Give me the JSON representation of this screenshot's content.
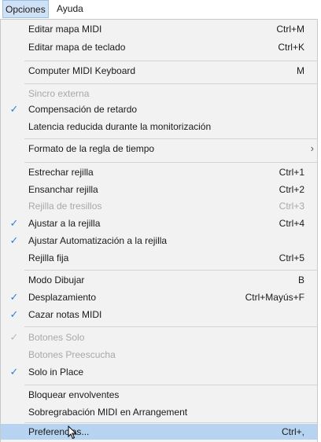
{
  "menubar": {
    "opciones": "Opciones",
    "ayuda": "Ayuda"
  },
  "menu": {
    "editar_mapa_midi": {
      "label": "Editar mapa MIDI",
      "shortcut": "Ctrl+M"
    },
    "editar_mapa_teclado": {
      "label": "Editar mapa de teclado",
      "shortcut": "Ctrl+K"
    },
    "computer_midi_keyboard": {
      "label": "Computer MIDI Keyboard",
      "shortcut": "M"
    },
    "sincro_externa": {
      "label": "Sincro externa"
    },
    "compensacion_retardo": {
      "label": "Compensación de retardo",
      "checked": true
    },
    "latencia_reducida": {
      "label": "Latencia reducida durante la monitorización"
    },
    "formato_regla": {
      "label": "Formato de la regla de tiempo",
      "submenu_arrow": "›"
    },
    "estrechar_rejilla": {
      "label": "Estrechar rejilla",
      "shortcut": "Ctrl+1"
    },
    "ensanchar_rejilla": {
      "label": "Ensanchar rejilla",
      "shortcut": "Ctrl+2"
    },
    "rejilla_tresillos": {
      "label": "Rejilla de tresillos",
      "shortcut": "Ctrl+3"
    },
    "ajustar_rejilla": {
      "label": "Ajustar a la rejilla",
      "shortcut": "Ctrl+4",
      "checked": true
    },
    "ajustar_automatizacion": {
      "label": "Ajustar Automatización a la rejilla",
      "checked": true
    },
    "rejilla_fija": {
      "label": "Rejilla fija",
      "shortcut": "Ctrl+5"
    },
    "modo_dibujar": {
      "label": "Modo Dibujar",
      "shortcut": "B"
    },
    "desplazamiento": {
      "label": "Desplazamiento",
      "shortcut": "Ctrl+Mayús+F",
      "checked": true
    },
    "cazar_notas": {
      "label": "Cazar notas MIDI",
      "checked": true
    },
    "botones_solo": {
      "label": "Botones Solo",
      "checked": true
    },
    "botones_preescucha": {
      "label": "Botones Preescucha"
    },
    "solo_in_place": {
      "label": "Solo in Place",
      "checked": true
    },
    "bloquear_envolventes": {
      "label": "Bloquear envolventes"
    },
    "sobregrabacion": {
      "label": "Sobregrabación MIDI en Arrangement"
    },
    "preferencias": {
      "label": "Preferencias...",
      "shortcut": "Ctrl+,"
    }
  },
  "icons": {
    "check": "✓"
  },
  "colors": {
    "highlight": "#b6d4f1",
    "check": "#2f7fd8",
    "disabled_text": "#a8a8a8"
  }
}
